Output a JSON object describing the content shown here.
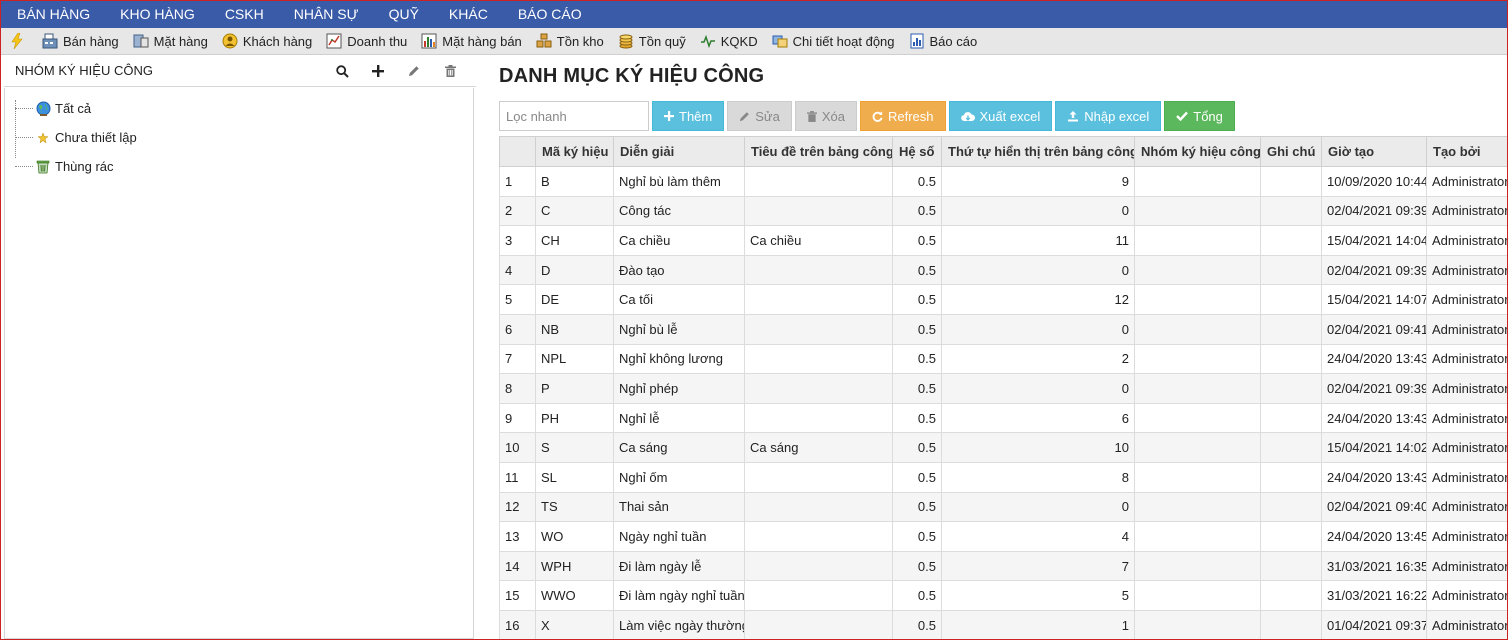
{
  "top_menu": [
    "BÁN HÀNG",
    "KHO HÀNG",
    "CSKH",
    "NHÂN SỰ",
    "QUỸ",
    "KHÁC",
    "BÁO CÁO"
  ],
  "toolbar": {
    "items": [
      {
        "label": "Bán hàng",
        "icon": "cash-register-icon"
      },
      {
        "label": "Mặt hàng",
        "icon": "product-icon"
      },
      {
        "label": "Khách hàng",
        "icon": "customer-icon"
      },
      {
        "label": "Doanh thu",
        "icon": "revenue-icon"
      },
      {
        "label": "Mặt hàng bán",
        "icon": "bar-chart-icon"
      },
      {
        "label": "Tồn kho",
        "icon": "stock-icon"
      },
      {
        "label": "Tồn quỹ",
        "icon": "coins-icon"
      },
      {
        "label": "KQKD",
        "icon": "line-chart-icon"
      },
      {
        "label": "Chi tiết hoạt động",
        "icon": "activity-icon"
      },
      {
        "label": "Báo cáo",
        "icon": "report-icon"
      }
    ]
  },
  "left_panel": {
    "title": "NHÓM KÝ HIỆU CÔNG",
    "tree": [
      {
        "label": "Tất cả",
        "icon": "globe-icon"
      },
      {
        "label": "Chưa thiết lập",
        "icon": "star-icon"
      },
      {
        "label": "Thùng rác",
        "icon": "trash-bin-icon"
      }
    ]
  },
  "main": {
    "title": "DANH MỤC KÝ HIỆU CÔNG",
    "filter_placeholder": "Lọc nhanh",
    "buttons": {
      "add": "Thêm",
      "edit": "Sửa",
      "delete": "Xóa",
      "refresh": "Refresh",
      "export": "Xuất excel",
      "import": "Nhập excel",
      "total": "Tổng"
    },
    "columns": [
      "",
      "Mã ký hiệu",
      "Diễn giải",
      "Tiêu đề trên bảng công",
      "Hệ số",
      "Thứ tự hiển thị trên bảng công",
      "Nhóm ký hiệu công",
      "Ghi chú",
      "Giờ tạo",
      "Tạo bởi"
    ],
    "rows": [
      [
        "1",
        "B",
        "Nghỉ bù làm thêm",
        "",
        "0.5",
        "9",
        "",
        "",
        "10/09/2020 10:44",
        "Administrator"
      ],
      [
        "2",
        "C",
        "Công tác",
        "",
        "0.5",
        "0",
        "",
        "",
        "02/04/2021 09:39",
        "Administrator"
      ],
      [
        "3",
        "CH",
        "Ca chiều",
        "Ca chiều",
        "0.5",
        "11",
        "",
        "",
        "15/04/2021 14:04",
        "Administrator"
      ],
      [
        "4",
        "D",
        "Đào tạo",
        "",
        "0.5",
        "0",
        "",
        "",
        "02/04/2021 09:39",
        "Administrator"
      ],
      [
        "5",
        "DE",
        "Ca tối",
        "",
        "0.5",
        "12",
        "",
        "",
        "15/04/2021 14:07",
        "Administrator"
      ],
      [
        "6",
        "NB",
        "Nghỉ bù lễ",
        "",
        "0.5",
        "0",
        "",
        "",
        "02/04/2021 09:41",
        "Administrator"
      ],
      [
        "7",
        "NPL",
        "Nghỉ không lương",
        "",
        "0.5",
        "2",
        "",
        "",
        "24/04/2020 13:43",
        "Administrator"
      ],
      [
        "8",
        "P",
        "Nghỉ phép",
        "",
        "0.5",
        "0",
        "",
        "",
        "02/04/2021 09:39",
        "Administrator"
      ],
      [
        "9",
        "PH",
        "Nghỉ lễ",
        "",
        "0.5",
        "6",
        "",
        "",
        "24/04/2020 13:43",
        "Administrator"
      ],
      [
        "10",
        "S",
        "Ca sáng",
        "Ca sáng",
        "0.5",
        "10",
        "",
        "",
        "15/04/2021 14:02",
        "Administrator"
      ],
      [
        "11",
        "SL",
        "Nghỉ ốm",
        "",
        "0.5",
        "8",
        "",
        "",
        "24/04/2020 13:43",
        "Administrator"
      ],
      [
        "12",
        "TS",
        "Thai sản",
        "",
        "0.5",
        "0",
        "",
        "",
        "02/04/2021 09:40",
        "Administrator"
      ],
      [
        "13",
        "WO",
        "Ngày nghỉ tuần",
        "",
        "0.5",
        "4",
        "",
        "",
        "24/04/2020 13:45",
        "Administrator"
      ],
      [
        "14",
        "WPH",
        "Đi làm ngày lễ",
        "",
        "0.5",
        "7",
        "",
        "",
        "31/03/2021 16:35",
        "Administrator"
      ],
      [
        "15",
        "WWO",
        "Đi làm ngày nghỉ tuần",
        "",
        "0.5",
        "5",
        "",
        "",
        "31/03/2021 16:22",
        "Administrator"
      ],
      [
        "16",
        "X",
        "Làm việc ngày thường",
        "",
        "0.5",
        "1",
        "",
        "",
        "01/04/2021 09:37",
        "Administrator"
      ]
    ]
  }
}
